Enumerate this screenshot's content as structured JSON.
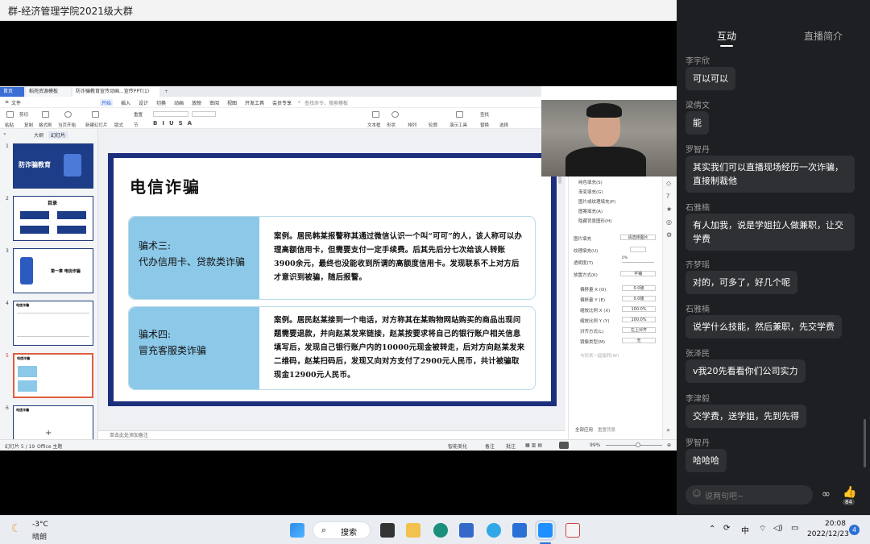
{
  "window": {
    "title": "群-经济管理学院2021级大群"
  },
  "ppt": {
    "tabs": [
      "首页",
      "稻壳资源模板",
      "防诈骗教育宣传动画...宣传PPT(1)"
    ],
    "menu": [
      "文件",
      "开始",
      "插入",
      "设计",
      "切换",
      "动画",
      "放映",
      "审阅",
      "视图",
      "开发工具",
      "会员专享"
    ],
    "search_placeholder": "查找命令、搜索模板",
    "ribbon": [
      "粘贴",
      "剪切",
      "复制",
      "格式刷",
      "当页开始",
      "新建幻灯片",
      "版式",
      "节",
      "重置",
      "文本框",
      "形状",
      "排列",
      "轮廓",
      "演示工具",
      "替换",
      "选择",
      "查找"
    ],
    "view_tabs": [
      "大纲",
      "幻灯片"
    ],
    "thumbs": [
      {
        "num": "1",
        "title": "防诈骗教育"
      },
      {
        "num": "2",
        "title": "目录"
      },
      {
        "num": "3",
        "title": "第一章 电信诈骗"
      },
      {
        "num": "4",
        "title": "电信诈骗"
      },
      {
        "num": "5",
        "title": "电信诈骗"
      },
      {
        "num": "6",
        "title": "电信诈骗"
      }
    ],
    "slide": {
      "title": "电信诈骗",
      "cases": [
        {
          "label_line1": "骗术三:",
          "label_line2": "代办信用卡、贷款类诈骗",
          "text": "案例。居民韩某报警称其通过微信认识一个叫“可可”的人，该人称可以办理高额信用卡，但需要支付一定手续费。后其先后分七次给该人转账3900余元，最终也没能收到所谓的高额度信用卡。发现联系不上对方后才意识到被骗，随后报警。"
        },
        {
          "label_line1": "骗术四:",
          "label_line2": "冒充客服类诈骗",
          "text": "案例。居民赵某接到一个电话，对方称其在某购物网站购买的商品出现问题需要退款，并向赵某发来链接，赵某按要求将自己的银行账户相关信息填写后，发现自己银行账户内的10000元现金被转走，后对方向赵某发来二维码，赵某扫码后，发现又向对方支付了2900元人民币，共计被骗取现金12900元人民币。"
        }
      ]
    },
    "notes_placeholder": "单击此处添加备注",
    "props": {
      "header": "填充",
      "section": "填充",
      "options": [
        "纯色填充(S)",
        "渐变填充(G)",
        "图片或纹理填充(P)",
        "图案填充(A)",
        "隐藏背景图形(H)"
      ],
      "rows": [
        {
          "label": "图片填充",
          "value": "请选择图片"
        },
        {
          "label": "纹理填充(U)",
          "value": ""
        },
        {
          "label": "透明度(T)",
          "value": "0%"
        },
        {
          "label": "放置方式(K)",
          "value": "平铺"
        },
        {
          "label": "偏移量 X (O)",
          "value": "0.0磅"
        },
        {
          "label": "偏移量 Y (E)",
          "value": "0.0磅"
        },
        {
          "label": "缩放比例 X (X)",
          "value": "100.0%"
        },
        {
          "label": "缩放比例 Y (Y)",
          "value": "100.0%"
        },
        {
          "label": "对齐方式(L)",
          "value": "左上对齐"
        },
        {
          "label": "镜像类型(M)",
          "value": "无"
        }
      ],
      "with_shape": "与形状一起旋转(W)",
      "apply_all": "全部应用",
      "reset": "重置背景"
    },
    "status": {
      "slide_pos": "幻灯片 5 / 19",
      "theme": "Office 主题",
      "smart_beautify": "智能美化",
      "notes": "备注",
      "comments": "批注",
      "zoom": "99%"
    }
  },
  "chat": {
    "tabs": [
      "互动",
      "直播简介"
    ],
    "messages": [
      {
        "name": "李宇欣",
        "text": "可以可以"
      },
      {
        "name": "梁倩文",
        "text": "能"
      },
      {
        "name": "罗智丹",
        "text": "其实我们可以直播现场经历一次诈骗，直接制裁他"
      },
      {
        "name": "石雅楠",
        "text": "有人加我，说是学姐拉人做兼职，让交学费"
      },
      {
        "name": "齐梦瑶",
        "text": "对的，可多了，好几个呢"
      },
      {
        "name": "石雅楠",
        "text": "说学什么技能，然后兼职，先交学费"
      },
      {
        "name": "张泽民",
        "text": "v我20先看看你们公司实力"
      },
      {
        "name": "李津毅",
        "text": "交学费，送学姐，先到先得"
      },
      {
        "name": "罗智丹",
        "text": "哈哈哈"
      }
    ],
    "input_placeholder": "说两句吧~",
    "like_count": "84"
  },
  "taskbar": {
    "weather_temp": "-3°C",
    "weather_desc": "晴朗",
    "search_label": "搜索",
    "ime": "中",
    "time": "20:08",
    "date": "2022/12/23",
    "notif_count": "4"
  }
}
